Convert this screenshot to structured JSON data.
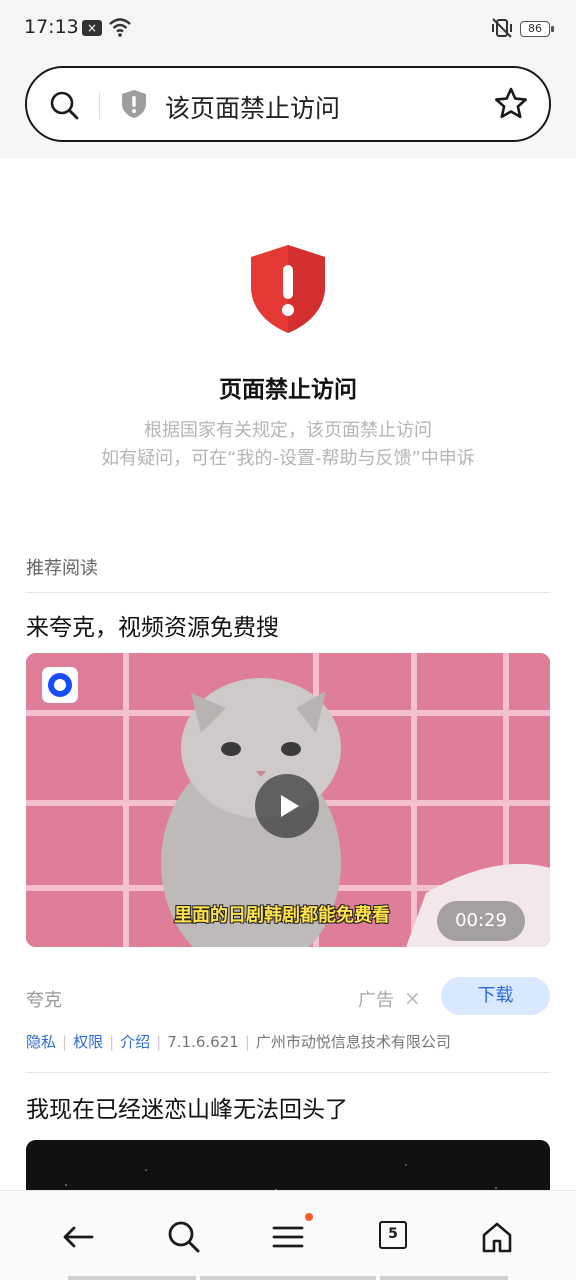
{
  "status_bar": {
    "time": "17:13",
    "battery": "86",
    "icons": [
      "notification-x-icon",
      "wifi-icon",
      "vibrate-icon",
      "battery-icon"
    ]
  },
  "address_bar": {
    "text": "该页面禁止访问",
    "icons": [
      "search-icon",
      "shield-icon",
      "star-icon"
    ]
  },
  "blocked": {
    "title": "页面禁止访问",
    "line1": "根据国家有关规定，该页面禁止访问",
    "line2": "如有疑问，可在“我的-设置-帮助与反馈”中申诉",
    "accent": "#e53935"
  },
  "recommend": {
    "label": "推荐阅读",
    "ad": {
      "title": "来夸克，视频资源免费搜",
      "video_subtitle": "里面的日剧韩剧都能免费看",
      "duration": "00:29",
      "app_name": "夸克",
      "ad_tag": "广告",
      "close": "×",
      "download": "下载",
      "meta": {
        "privacy": "隐私",
        "permissions": "权限",
        "intro": "介绍",
        "version": "7.1.6.621",
        "company": "广州市动悦信息技术有限公司"
      }
    },
    "article": {
      "title": "我现在已经迷恋山峰无法回头了"
    }
  },
  "bottom_nav": {
    "tab_count": "5",
    "items": [
      "back-icon",
      "search-icon",
      "menu-icon",
      "tabs-icon",
      "home-icon"
    ]
  },
  "colors": {
    "link": "#2d6bd6",
    "download_bg": "#d8e8ff",
    "notification_dot": "#ff5a2d"
  }
}
